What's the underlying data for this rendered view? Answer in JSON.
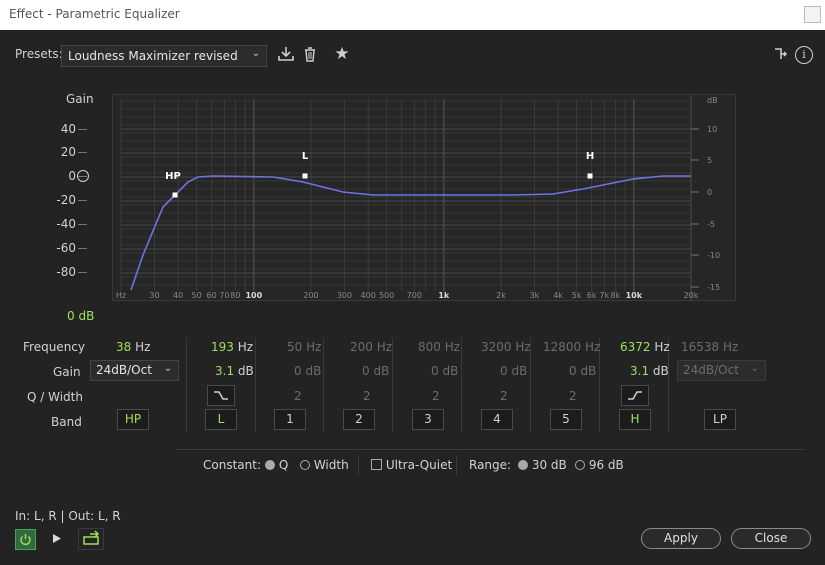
{
  "window": {
    "title": "Effect - Parametric Equalizer"
  },
  "presets": {
    "label": "Presets:",
    "value": "Loudness Maximizer revised"
  },
  "graph": {
    "gain_title": "Gain",
    "gain_unit": "0 dB",
    "left_ticks": [
      "40",
      "20",
      "0",
      "-20",
      "-40",
      "-60",
      "-80"
    ],
    "right_unit": "dB",
    "right_ticks": [
      "10",
      "5",
      "0",
      "-5",
      "-10",
      "-15"
    ],
    "freq_ticks": [
      "Hz",
      "30",
      "40",
      "50",
      "60",
      "70",
      "80",
      "100",
      "200",
      "300",
      "400",
      "500",
      "700",
      "1k",
      "2k",
      "3k",
      "4k",
      "5k",
      "6k",
      "7k",
      "8k",
      "10k",
      "20k"
    ],
    "handle_labels": {
      "hp": "HP",
      "l": "L",
      "h": "H"
    }
  },
  "rows": {
    "frequency": "Frequency",
    "gain": "Gain",
    "q_width": "Q / Width",
    "band": "Band"
  },
  "bands": {
    "hp": {
      "freq": "38",
      "freq_unit": "Hz",
      "slope": "24dB/Oct",
      "label": "HP"
    },
    "l": {
      "freq": "193",
      "freq_unit": "Hz",
      "gain": "3.1",
      "gain_unit": "dB",
      "label": "L"
    },
    "b1": {
      "freq": "50 Hz",
      "gain": "0 dB",
      "q": "2",
      "label": "1"
    },
    "b2": {
      "freq": "200 Hz",
      "gain": "0 dB",
      "q": "2",
      "label": "2"
    },
    "b3": {
      "freq": "800 Hz",
      "gain": "0 dB",
      "q": "2",
      "label": "3"
    },
    "b4": {
      "freq": "3200 Hz",
      "gain": "0 dB",
      "q": "2",
      "label": "4"
    },
    "b5": {
      "freq": "12800 Hz",
      "gain": "0 dB",
      "q": "2",
      "label": "5"
    },
    "h": {
      "freq": "6372",
      "freq_unit": "Hz",
      "gain": "3.1",
      "gain_unit": "dB",
      "label": "H"
    },
    "lp": {
      "freq": "16538 Hz",
      "slope": "24dB/Oct",
      "label": "LP"
    }
  },
  "options": {
    "constant_label": "Constant:",
    "q_label": "Q",
    "width_label": "Width",
    "ultra_quiet_label": "Ultra-Quiet",
    "range_label": "Range:",
    "range_30": "30 dB",
    "range_96": "96 dB"
  },
  "footer": {
    "io": "In: L, R | Out: L, R",
    "apply": "Apply",
    "close": "Close"
  },
  "colors": {
    "accent_green": "#9ee05b",
    "curve": "#6f74e0"
  }
}
